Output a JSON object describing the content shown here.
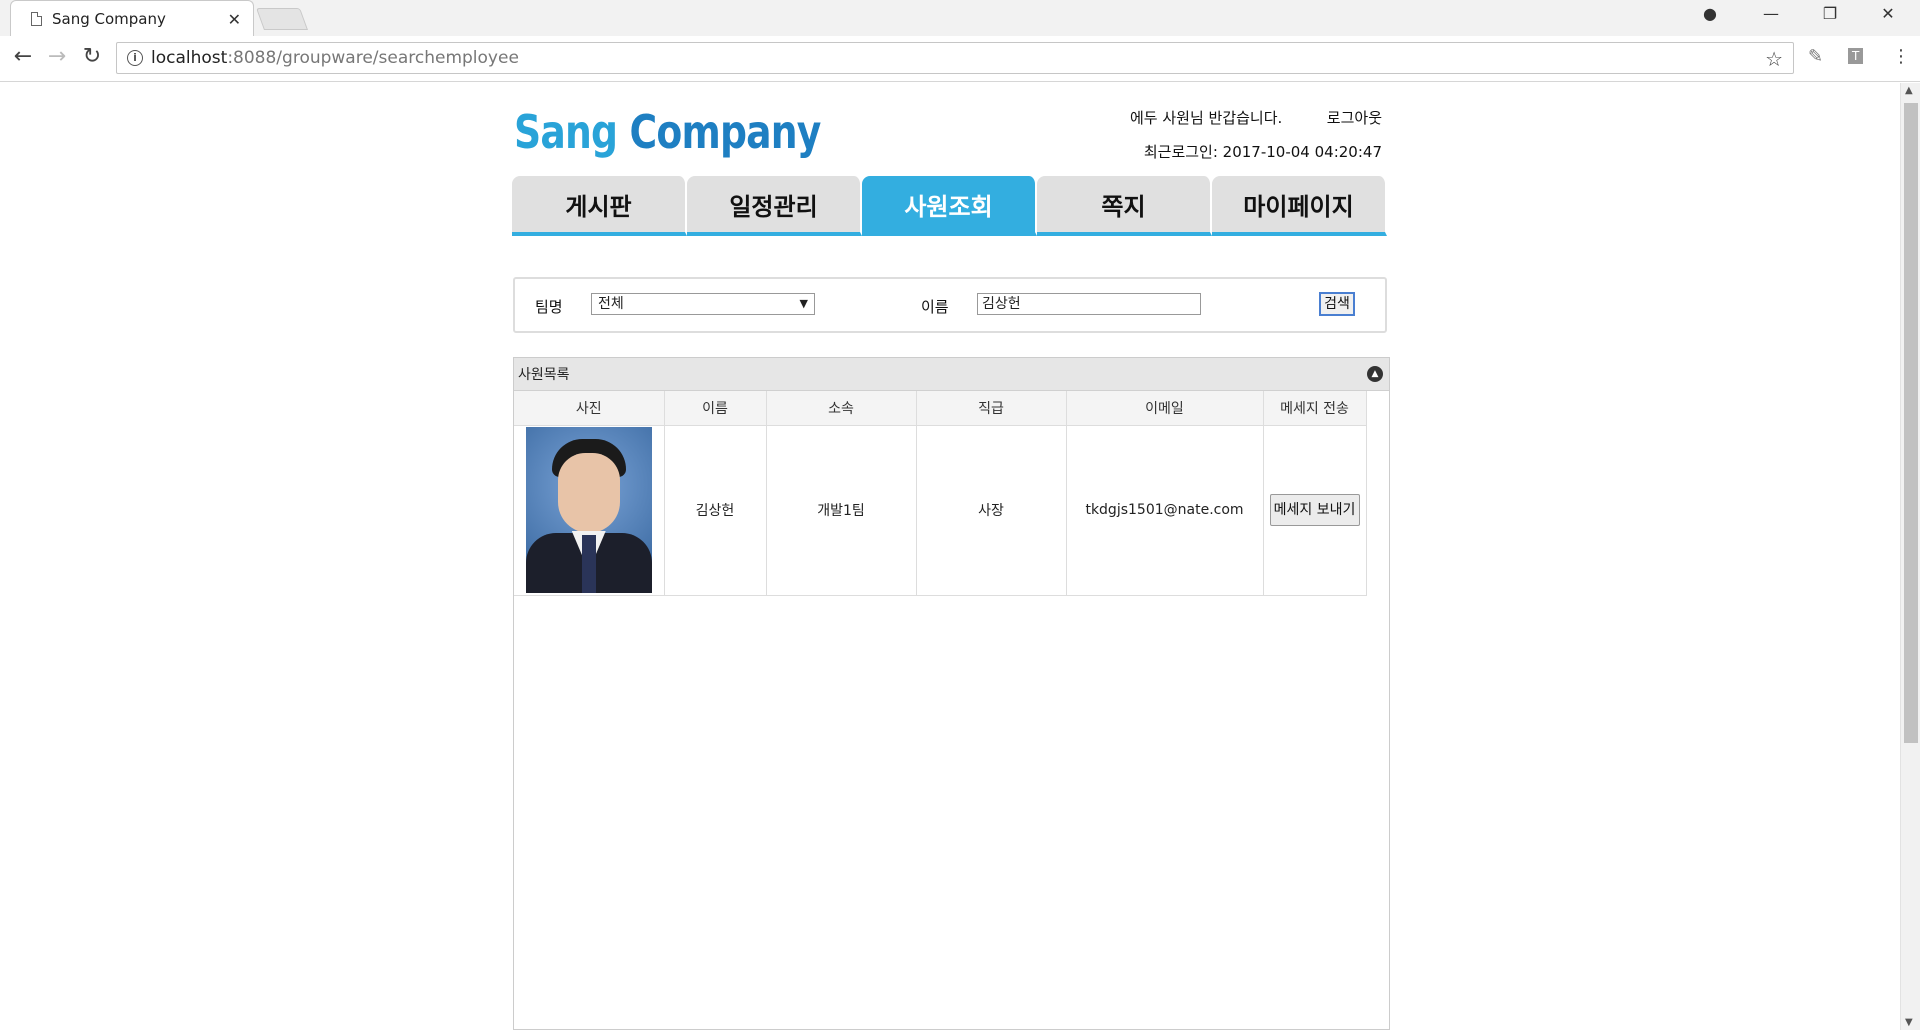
{
  "browser": {
    "tab_title": "Sang Company",
    "url_host": "localhost",
    "url_path": ":8088/groupware/searchemployee"
  },
  "header": {
    "logo_main": "Sang",
    "logo_sub": "Company",
    "greeting": "에두 사원님 반갑습니다.",
    "logout": "로그아웃",
    "last_login": "최근로그인: 2017-10-04 04:20:47"
  },
  "menu": {
    "tabs": [
      {
        "label": "게시판",
        "active": false
      },
      {
        "label": "일정관리",
        "active": false
      },
      {
        "label": "사원조회",
        "active": true
      },
      {
        "label": "쪽지",
        "active": false
      },
      {
        "label": "마이페이지",
        "active": false
      }
    ]
  },
  "search": {
    "team_label": "팀명",
    "team_value": "전체",
    "name_label": "이름",
    "name_value": "김상헌",
    "button": "검색"
  },
  "grid": {
    "caption": "사원목록",
    "columns": [
      "사진",
      "이름",
      "소속",
      "직급",
      "이메일",
      "메세지 전송"
    ],
    "rows": [
      {
        "name": "김상헌",
        "team": "개발1팀",
        "rank": "사장",
        "email": "tkdgjs1501@nate.com",
        "action": "메세지 보내기"
      }
    ]
  },
  "colors": {
    "accent": "#33aee0",
    "logo": "#29a3d8"
  }
}
